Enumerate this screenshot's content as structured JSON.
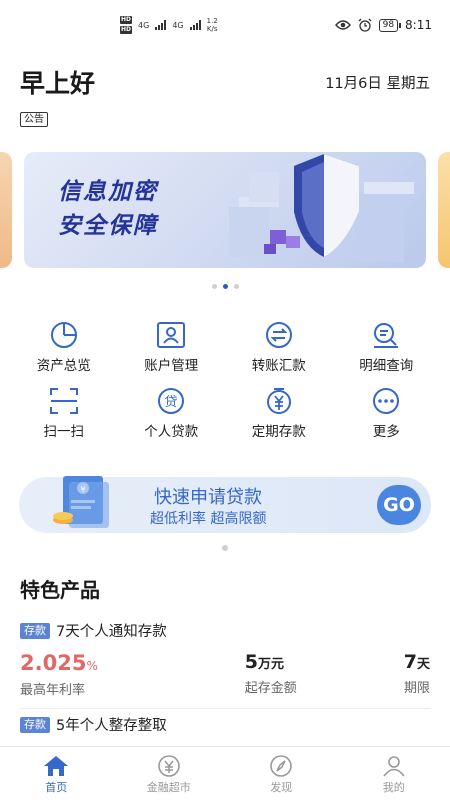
{
  "status_bar": {
    "net1": "4G",
    "net2": "4G",
    "speed_value": "1.2",
    "speed_unit": "K/s",
    "battery": "98",
    "time": "8:11"
  },
  "header": {
    "greeting": "早上好",
    "date": "11月6日 星期五",
    "notice": "公告"
  },
  "banner": {
    "line1": "信息加密",
    "line2": "安全保障",
    "dot_count": 3,
    "active_dot": 1
  },
  "functions": [
    {
      "label": "资产总览",
      "icon": "pie-chart-icon"
    },
    {
      "label": "账户管理",
      "icon": "account-card-icon"
    },
    {
      "label": "转账汇款",
      "icon": "transfer-icon"
    },
    {
      "label": "明细查询",
      "icon": "detail-search-icon"
    },
    {
      "label": "扫一扫",
      "icon": "scan-icon"
    },
    {
      "label": "个人贷款",
      "icon": "loan-icon"
    },
    {
      "label": "定期存款",
      "icon": "deposit-icon"
    },
    {
      "label": "更多",
      "icon": "more-icon"
    }
  ],
  "loan_banner": {
    "title": "快速申请贷款",
    "subtitle": "超低利率 超高限额",
    "button": "GO"
  },
  "featured": {
    "title": "特色产品",
    "products": [
      {
        "tag": "存款",
        "name": "7天个人通知存款",
        "rate": "2.025",
        "rate_unit": "%",
        "rate_label": "最高年利率",
        "min_amount": "5",
        "min_amount_unit": "万元",
        "min_amount_label": "起存金额",
        "term": "7",
        "term_unit": "天",
        "term_label": "期限"
      },
      {
        "tag": "存款",
        "name": "5年个人整存整取"
      }
    ]
  },
  "tabbar": [
    {
      "label": "首页",
      "icon": "home-icon",
      "active": true
    },
    {
      "label": "金融超市",
      "icon": "yuan-icon",
      "active": false
    },
    {
      "label": "发现",
      "icon": "compass-icon",
      "active": false
    },
    {
      "label": "我的",
      "icon": "user-icon",
      "active": false
    }
  ],
  "colors": {
    "accent": "#3568c8",
    "rate": "#e06868",
    "tag": "#5c84d6"
  }
}
